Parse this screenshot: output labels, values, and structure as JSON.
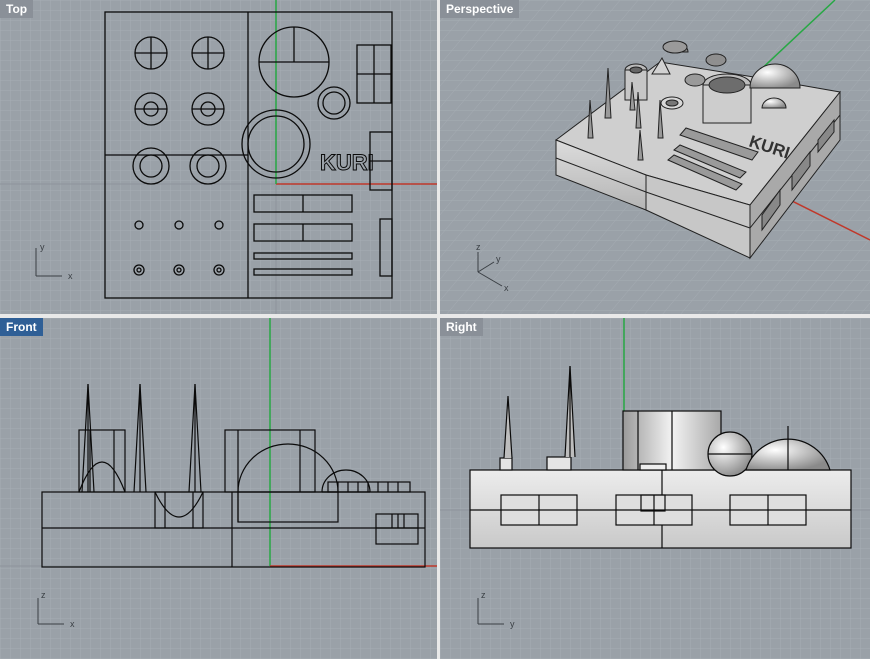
{
  "viewports": {
    "top": {
      "title": "Top",
      "active": false,
      "axis_labels": {
        "a": "y",
        "b": "x"
      }
    },
    "perspective": {
      "title": "Perspective",
      "active": false,
      "axis_labels": {
        "a": "z",
        "b": "y",
        "c": "x"
      }
    },
    "front": {
      "title": "Front",
      "active": true,
      "axis_labels": {
        "a": "z",
        "b": "x"
      }
    },
    "right": {
      "title": "Right",
      "active": false,
      "axis_labels": {
        "a": "z",
        "b": "y"
      }
    }
  },
  "model_text": "KURI",
  "colors": {
    "viewport_bg": "#9aa1a8",
    "grid_minor": "#a6adb4",
    "grid_major": "#8d949b",
    "x_axis": "#c0392b",
    "y_axis": "#27a844",
    "title_bg": "#8a9098",
    "title_active_bg": "#2f5f96",
    "wire": "#0b0b0b"
  }
}
